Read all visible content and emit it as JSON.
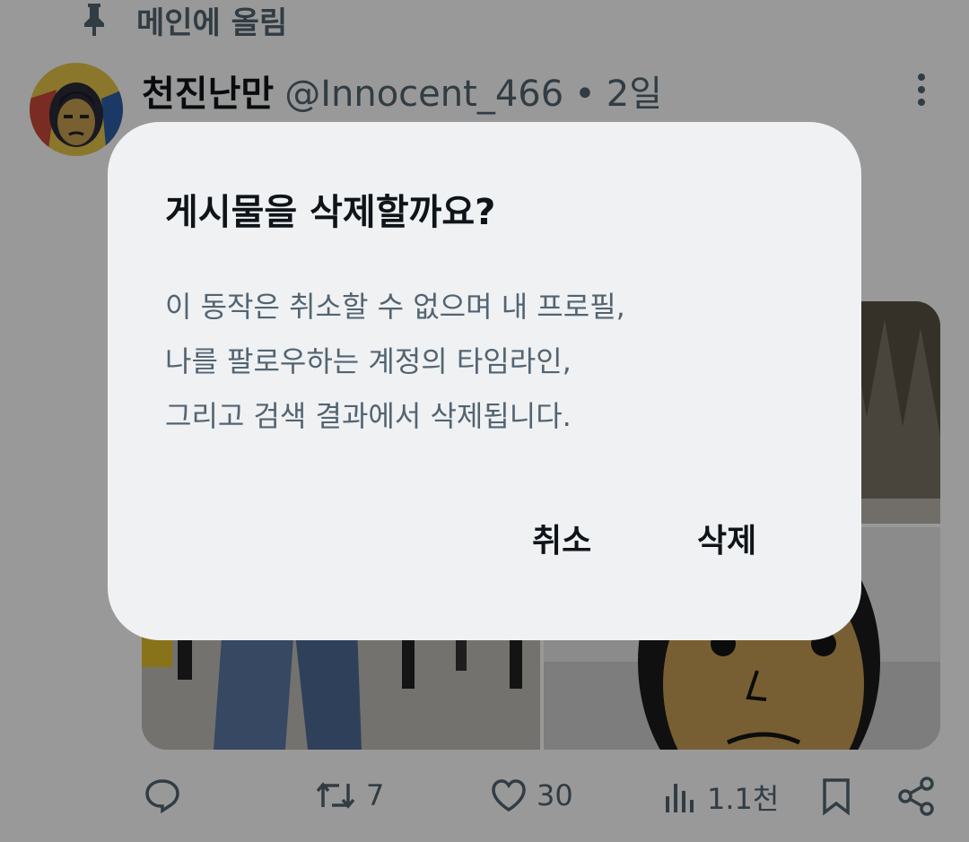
{
  "post": {
    "pinned_label": "메인에 올림",
    "display_name": "천진난만",
    "handle": "@Innocent_466",
    "separator": "•",
    "time": "2일"
  },
  "actions": {
    "reply_count": "",
    "repost_count": "7",
    "like_count": "30",
    "view_count": "1.1천"
  },
  "dialog": {
    "title": "게시물을 삭제할까요?",
    "body_lines": [
      "이 동작은 취소할 수 없으며 내 프로필,",
      "나를 팔로우하는 계정의 타임라인,",
      "그리고 검색 결과에서 삭제됩니다."
    ],
    "cancel_label": "취소",
    "delete_label": "삭제"
  },
  "icons": [
    "pin-icon",
    "more-icon",
    "reply-icon",
    "repost-icon",
    "like-icon",
    "views-icon",
    "bookmark-icon",
    "share-icon"
  ]
}
